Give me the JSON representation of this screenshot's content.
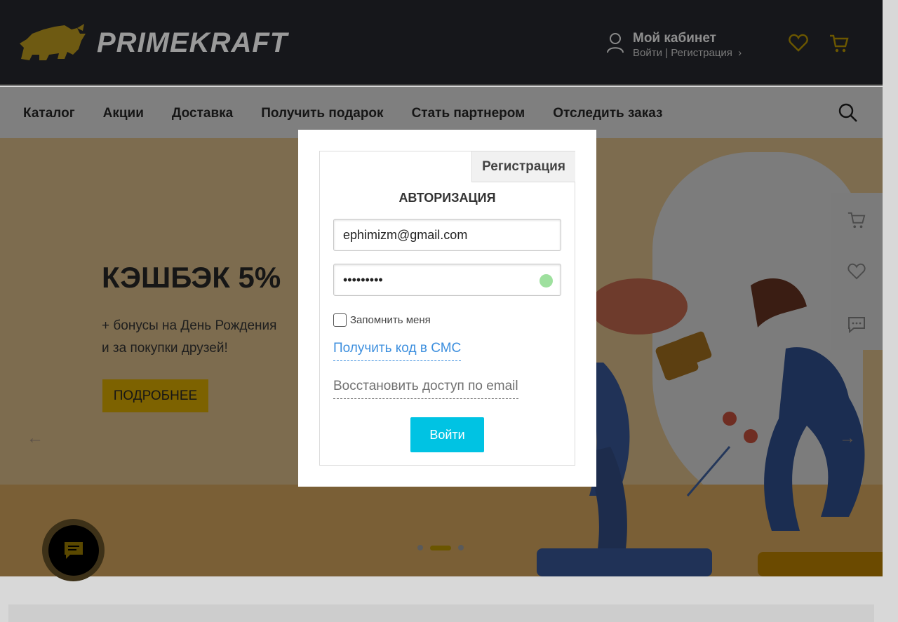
{
  "header": {
    "logo_text": "PRIMEKRAFT",
    "cabinet_title": "Мой кабинет",
    "login_link": "Войти",
    "separator": "|",
    "register_link": "Регистрация",
    "chevron": "›",
    "icons": [
      "user-icon",
      "heart-icon",
      "cart-icon"
    ],
    "accent_color": "#caa400"
  },
  "nav": {
    "items": [
      "Каталог",
      "Акции",
      "Доставка",
      "Получить подарок",
      "Стать партнером",
      "Отследить заказ"
    ],
    "search_icon": "search-icon"
  },
  "hero": {
    "title": "КЭШБЭК 5%",
    "subtitle_line1": "+ бонусы на День Рождения",
    "subtitle_line2": "и за покупки друзей!",
    "button": "ПОДРОБНЕЕ",
    "arrow_left": "←",
    "arrow_right": "→",
    "slides_total": 3,
    "active_slide": 2
  },
  "side_panel": {
    "icons": [
      "cart-icon",
      "heart-icon",
      "chat-icon"
    ]
  },
  "modal": {
    "register_tab": "Регистрация",
    "title": "АВТОРИЗАЦИЯ",
    "email_value": "ephimizm@gmail.com",
    "password_value": "•••••••••",
    "remember_label": "Запомнить меня",
    "remember_checked": false,
    "sms_link": "Получить код в СМС",
    "restore_link": "Восстановить доступ по email",
    "login_button": "Войти",
    "button_color": "#00c3e3"
  }
}
